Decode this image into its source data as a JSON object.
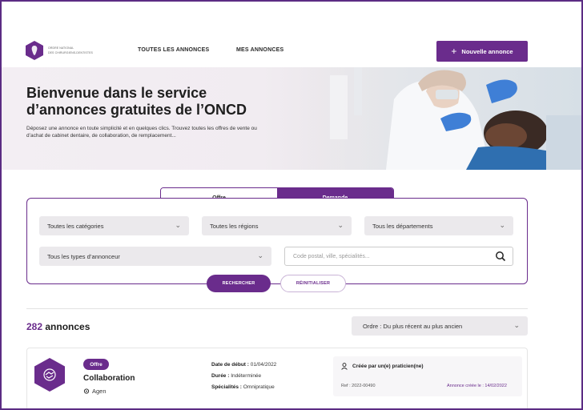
{
  "header": {
    "logo_lines": [
      "ORDRE NATIONAL",
      "DES CHIRURGIENS-DENTISTES"
    ],
    "nav": [
      "TOUTES LES ANNONCES",
      "MES ANNONCES"
    ],
    "new_button": "Nouvelle annonce"
  },
  "hero": {
    "title": "Bienvenue dans le service d’annonces gratuites de l’ONCD",
    "description": "Déposez une annonce en toute simplicité et en quelques clics. Trouvez toutes les offres de vente ou d’achat de cabinet dentaire, de collaboration, de remplacement..."
  },
  "search": {
    "tabs": {
      "offre": "Offre",
      "demande": "Demande",
      "active": "demande"
    },
    "categories": "Toutes les catégories",
    "regions": "Toutes les régions",
    "departements": "Tous les départements",
    "annonceur_types": "Tous les types d’annonceur",
    "input_placeholder": "Code postal, ville, spécialités...",
    "search_button": "RECHERCHER",
    "reset_button": "RÉINITIALISER"
  },
  "results": {
    "count": "282",
    "label": " annonces",
    "sort": "Ordre : Du plus récent au plus ancien"
  },
  "listing": {
    "badge": "Offre",
    "title": "Collaboration",
    "location": "Agen",
    "start_label": "Date de début :",
    "start_value": "01/04/2022",
    "duration_label": "Durée :",
    "duration_value": "Indéterminée",
    "specialty_label": "Spécialités :",
    "specialty_value": "Omnipratique",
    "creator": "Créée par un(e) praticien(ne)",
    "ref": "Ref : 2022-00490",
    "created": "Annonce créée le : 14/02/2022"
  },
  "colors": {
    "brand": "#6a2c8c"
  }
}
